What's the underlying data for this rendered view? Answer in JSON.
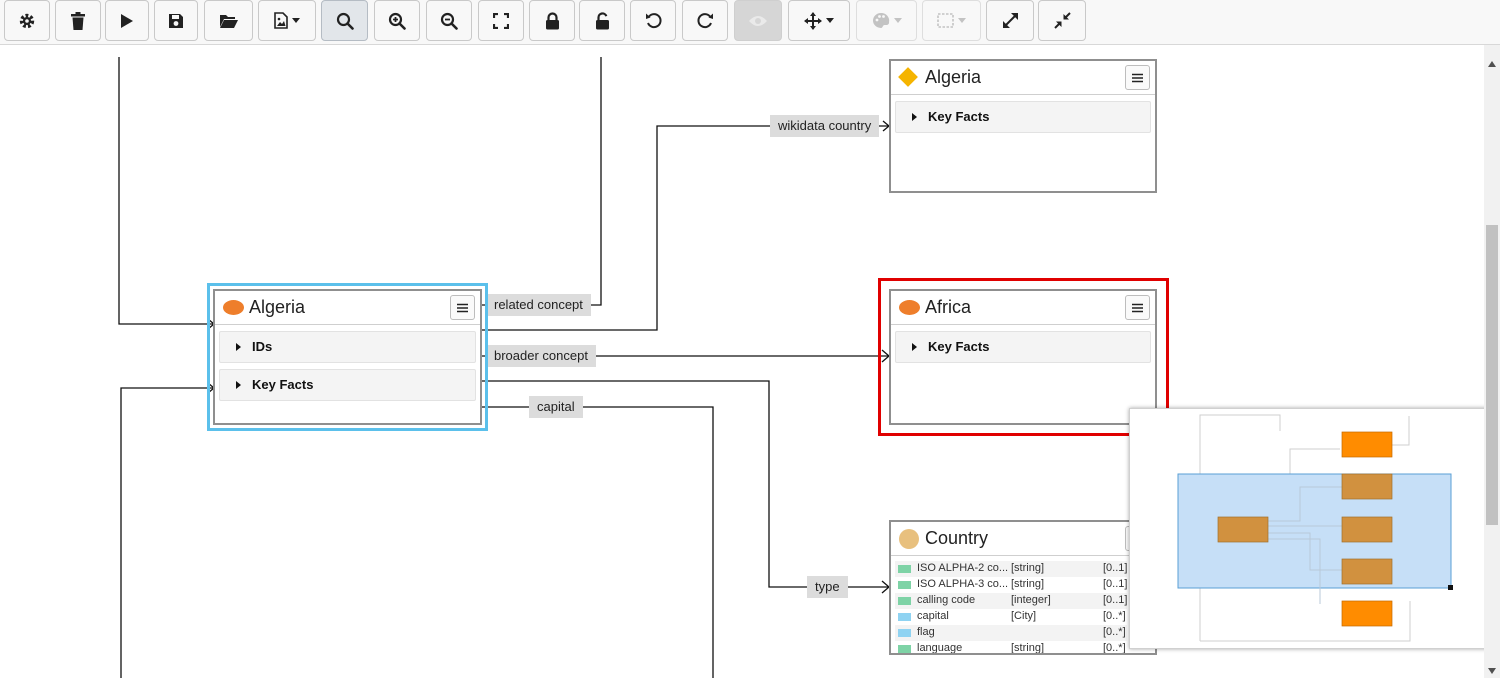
{
  "toolbar": {
    "buttons": [
      {
        "name": "settings",
        "icon": "gear-icon"
      },
      {
        "name": "delete",
        "icon": "trash-icon"
      },
      {
        "name": "run",
        "icon": "play-icon"
      },
      {
        "name": "save",
        "icon": "floppy-disk-icon"
      },
      {
        "name": "open",
        "icon": "folder-open-icon"
      },
      {
        "name": "export",
        "icon": "file-image-icon"
      },
      {
        "name": "search",
        "icon": "search-icon"
      },
      {
        "name": "zoom-in",
        "icon": "zoom-in-icon"
      },
      {
        "name": "zoom-out",
        "icon": "zoom-out-icon"
      },
      {
        "name": "fit",
        "icon": "expand-frame-icon"
      },
      {
        "name": "lock",
        "icon": "lock-icon"
      },
      {
        "name": "unlock",
        "icon": "unlock-icon"
      },
      {
        "name": "undo",
        "icon": "undo-icon"
      },
      {
        "name": "redo",
        "icon": "redo-icon"
      },
      {
        "name": "visibility",
        "icon": "eye-icon"
      },
      {
        "name": "move",
        "icon": "arrows-move-icon"
      },
      {
        "name": "palette",
        "icon": "palette-icon"
      },
      {
        "name": "selection",
        "icon": "dashed-box-icon"
      },
      {
        "name": "expand",
        "icon": "expand-arrows-icon"
      },
      {
        "name": "collapse",
        "icon": "compress-arrows-icon"
      }
    ]
  },
  "nodes": {
    "algeria_main": {
      "title": "Algeria",
      "sections": [
        "IDs",
        "Key Facts"
      ]
    },
    "algeria_wikidata": {
      "title": "Algeria",
      "sections": [
        "Key Facts"
      ]
    },
    "africa": {
      "title": "Africa",
      "sections": [
        "Key Facts"
      ]
    },
    "country": {
      "title": "Country",
      "attributes": [
        {
          "name": "ISO ALPHA-2 co...",
          "type": "[string]",
          "card": "[0..1]",
          "kind": "data"
        },
        {
          "name": "ISO ALPHA-3 co...",
          "type": "[string]",
          "card": "[0..1]",
          "kind": "data"
        },
        {
          "name": "calling code",
          "type": "[integer]",
          "card": "[0..1]",
          "kind": "data"
        },
        {
          "name": "capital",
          "type": "[City]",
          "card": "[0..*]",
          "kind": "relation"
        },
        {
          "name": "flag",
          "type": "",
          "card": "[0..*]",
          "kind": "relation"
        },
        {
          "name": "language",
          "type": "[string]",
          "card": "[0..*]",
          "kind": "data"
        }
      ]
    }
  },
  "edges": {
    "related_concept": "related concept",
    "wikidata_country": "wikidata country",
    "broader_concept": "broader concept",
    "capital": "capital",
    "type": "type"
  },
  "colors": {
    "selected_blue": "#5bc0eb",
    "selected_red": "#e00000",
    "instance_dot": "#ee7e2b",
    "wikidata_diamond": "#f5b400",
    "class_dot": "#e8c07e",
    "minimap_viewport": "#c6dff7",
    "minimap_node": "#ff8c00"
  }
}
